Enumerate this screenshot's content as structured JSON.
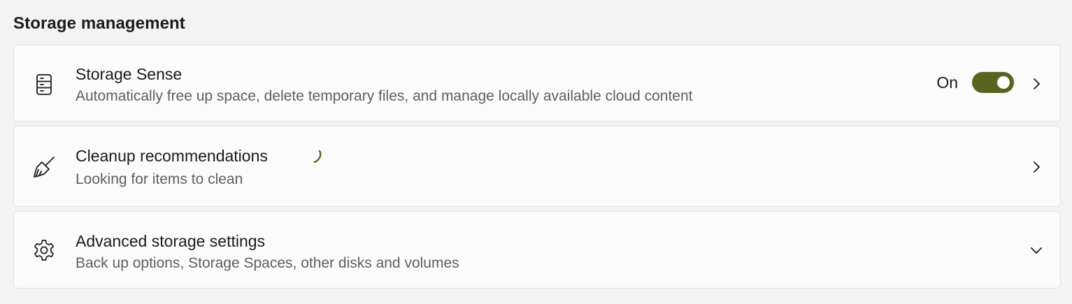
{
  "section": {
    "title": "Storage management"
  },
  "cards": [
    {
      "icon": "storage-drive-icon",
      "title": "Storage Sense",
      "description": "Automatically free up space, delete temporary files, and manage locally available cloud content",
      "toggle": {
        "label": "On",
        "state": true
      },
      "action_icon": "chevron-right-icon"
    },
    {
      "icon": "broom-icon",
      "title": "Cleanup recommendations",
      "description": "Looking for items to clean",
      "loading": true,
      "action_icon": "chevron-right-icon"
    },
    {
      "icon": "gear-icon",
      "title": "Advanced storage settings",
      "description": "Back up options, Storage Spaces, other disks and volumes",
      "action_icon": "chevron-down-icon"
    }
  ],
  "colors": {
    "accent": "#5a6320",
    "background": "#f3f3f3",
    "card": "#fbfbfb",
    "secondary_text": "#5f5f5f"
  }
}
